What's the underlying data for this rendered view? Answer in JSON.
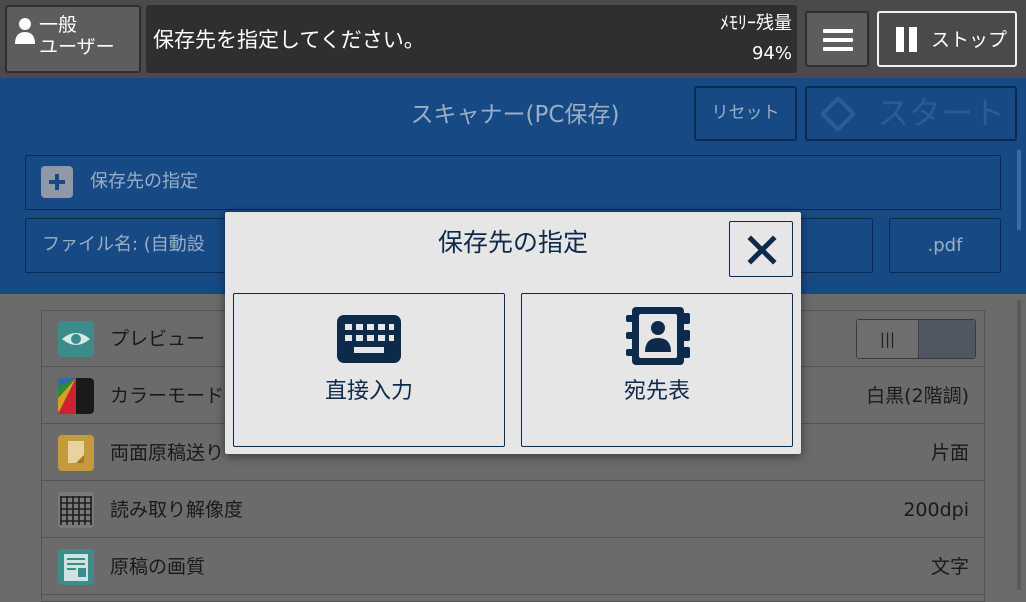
{
  "status_bar": {
    "user_line1": "一般",
    "user_line2": "ユーザー",
    "message": "保存先を指定してください。",
    "memory_label": "ﾒﾓﾘｰ残量",
    "memory_value": "94%",
    "stop_label": "ストップ"
  },
  "header": {
    "title": "スキャナー(PC保存)",
    "reset_label": "リセット",
    "start_label": "スタート",
    "destination_label": "保存先の指定",
    "filename_label": "ファイル名: (自動設",
    "extension": ".pdf"
  },
  "settings": [
    {
      "label": "プレビュー",
      "value": "",
      "icon": "eye-icon",
      "toggle_label": "|||"
    },
    {
      "label": "カラーモード",
      "value": "白黒(2階調)",
      "icon": "color-mode-icon"
    },
    {
      "label": "両面原稿送り",
      "value": "片面",
      "icon": "duplex-icon"
    },
    {
      "label": "読み取り解像度",
      "value": "200dpi",
      "icon": "resolution-grid-icon"
    },
    {
      "label": "原稿の画質",
      "value": "文字",
      "icon": "image-quality-icon"
    }
  ],
  "modal": {
    "title": "保存先の指定",
    "options": [
      {
        "label": "直接入力",
        "icon": "keyboard-icon"
      },
      {
        "label": "宛先表",
        "icon": "address-book-icon"
      }
    ]
  },
  "colors": {
    "header_blue": "#174a85",
    "modal_navy": "#0e2a4a",
    "modal_bg": "#e6e6e6"
  }
}
